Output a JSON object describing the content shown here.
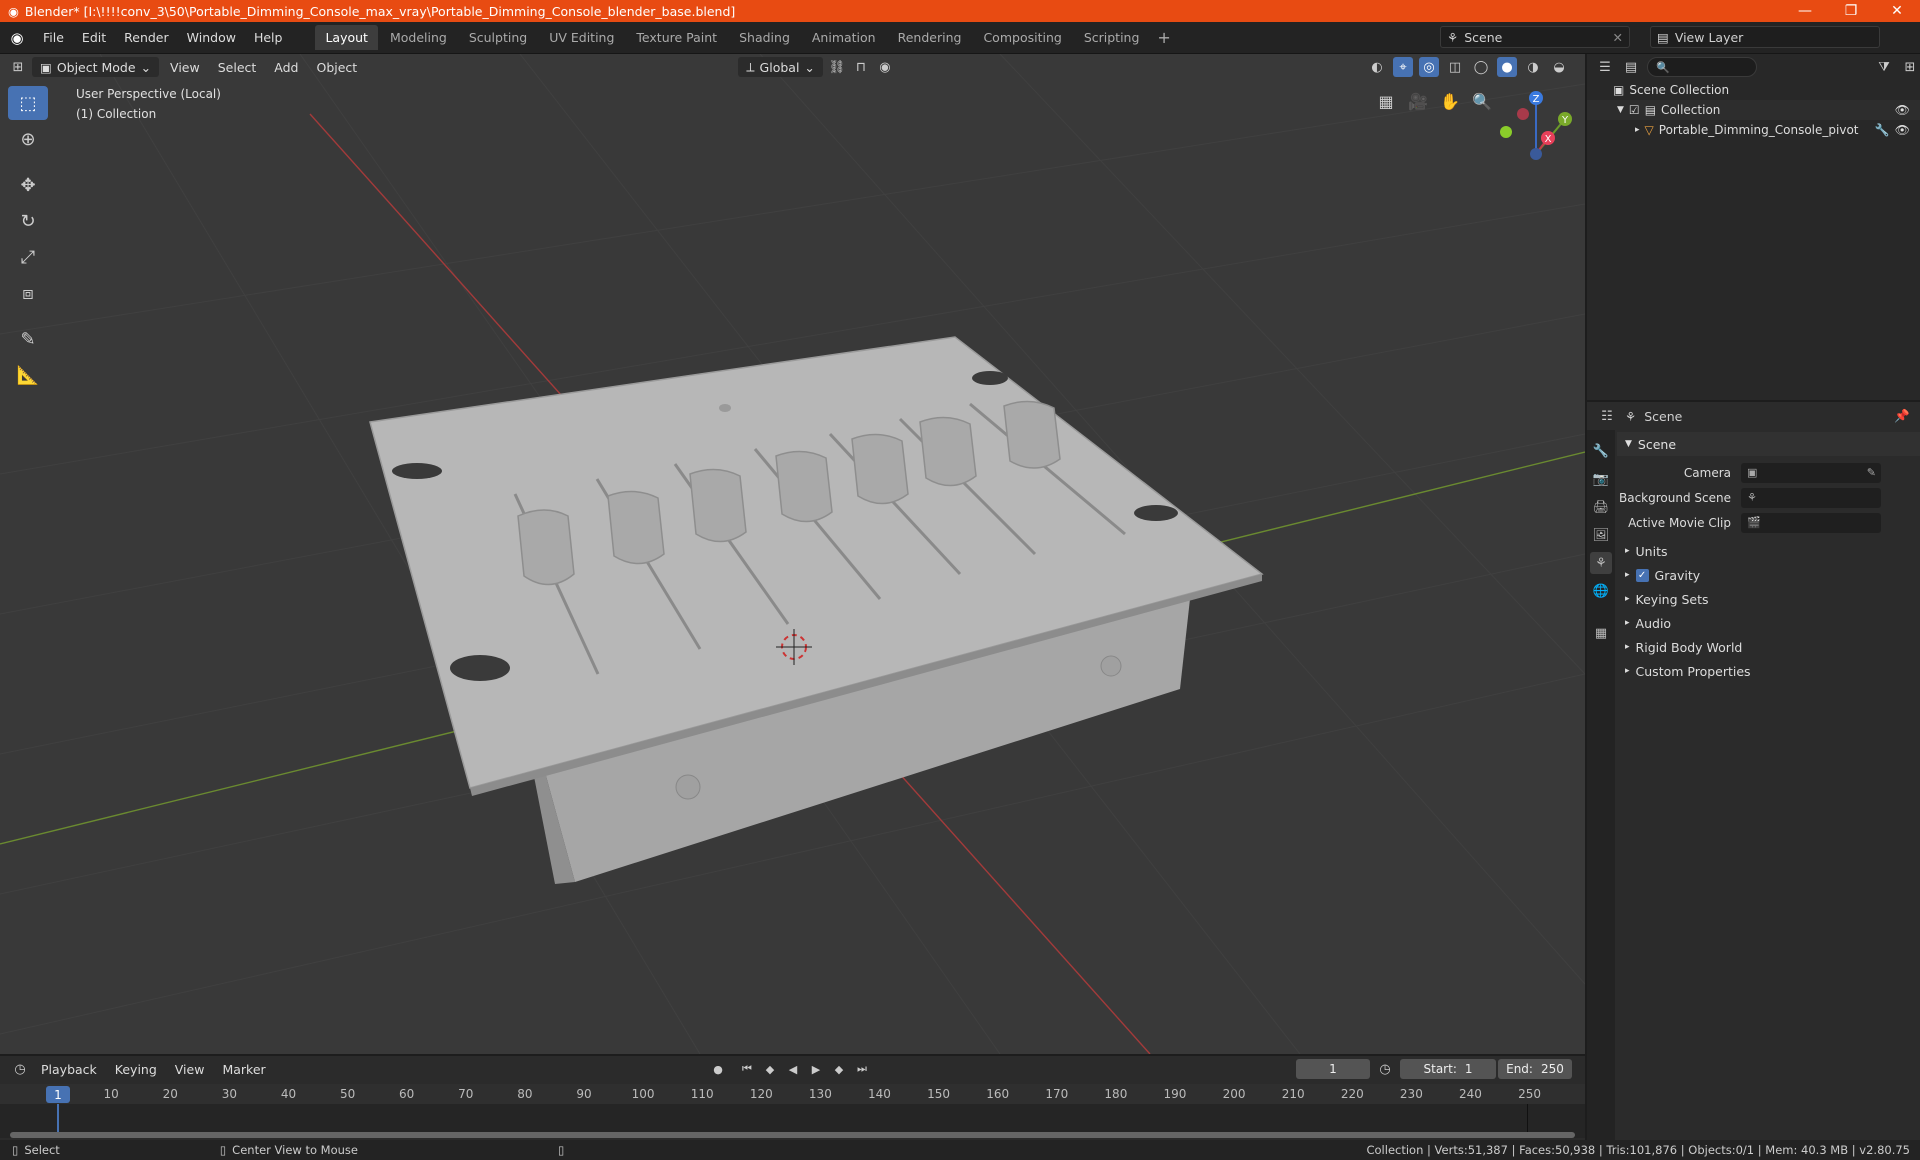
{
  "window": {
    "title": "Blender* [I:\\!!!!conv_3\\50\\Portable_Dimming_Console_max_vray\\Portable_Dimming_Console_blender_base.blend]"
  },
  "menu": [
    "File",
    "Edit",
    "Render",
    "Window",
    "Help"
  ],
  "workspaces": [
    "Layout",
    "Modeling",
    "Sculpting",
    "UV Editing",
    "Texture Paint",
    "Shading",
    "Animation",
    "Rendering",
    "Compositing",
    "Scripting"
  ],
  "scene_selector": "Scene",
  "view_layer": "View Layer",
  "viewport": {
    "mode": "Object Mode",
    "menus": [
      "View",
      "Select",
      "Add",
      "Object"
    ],
    "transform_orientation": "Global",
    "info_line1": "User Perspective (Local)",
    "info_line2": "(1) Collection",
    "gizmo": {
      "x": "X",
      "y": "Y",
      "z": "Z"
    }
  },
  "outliner": {
    "root": "Scene Collection",
    "collection": "Collection",
    "object": "Portable_Dimming_Console_pivot"
  },
  "properties": {
    "header": "Scene",
    "panel": "Scene",
    "camera_label": "Camera",
    "background_scene_label": "Background Scene",
    "active_movie_clip_label": "Active Movie Clip",
    "subpanels": [
      "Units",
      "Gravity",
      "Keying Sets",
      "Audio",
      "Rigid Body World",
      "Custom Properties"
    ]
  },
  "timeline": {
    "menus": [
      "Playback",
      "Keying",
      "View",
      "Marker"
    ],
    "current_frame": "1",
    "start_label": "Start:",
    "start": "1",
    "end_label": "End:",
    "end": "250",
    "ticks": [
      "1",
      "10",
      "20",
      "30",
      "40",
      "50",
      "60",
      "70",
      "80",
      "90",
      "100",
      "110",
      "120",
      "130",
      "140",
      "150",
      "160",
      "170",
      "180",
      "190",
      "200",
      "210",
      "220",
      "230",
      "240",
      "250"
    ]
  },
  "status": {
    "left": "Select",
    "middle": "Center View to Mouse",
    "stats": "Collection | Verts:51,387 | Faces:50,938 | Tris:101,876 | Objects:0/1 | Mem: 40.3 MB | v2.80.75"
  },
  "colors": {
    "title_bar": "#e84b12",
    "accent": "#4772b3",
    "viewport_bg": "#393939"
  }
}
